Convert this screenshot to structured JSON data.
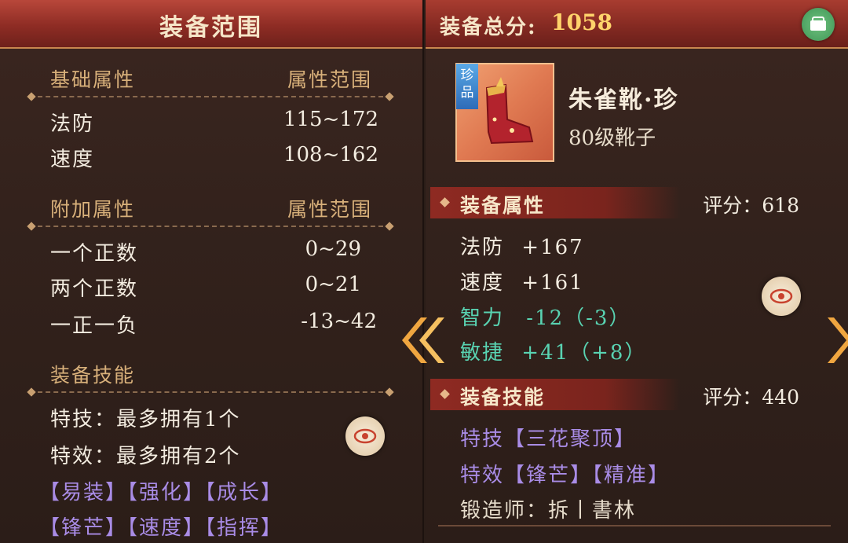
{
  "left_panel": {
    "title": "装备范围",
    "base_section": {
      "label": "基础属性",
      "range_label": "属性范围",
      "rows": [
        {
          "name": "法防",
          "range": "115~172"
        },
        {
          "name": "速度",
          "range": "108~162"
        }
      ]
    },
    "extra_section": {
      "label": "附加属性",
      "range_label": "属性范围",
      "rows": [
        {
          "name": "一个正数",
          "range": "0~29"
        },
        {
          "name": "两个正数",
          "range": "0~21"
        },
        {
          "name": "一正一负",
          "range": "-13~42"
        }
      ]
    },
    "skill_section": {
      "label": "装备技能",
      "stunt_line": "特技：最多拥有1个",
      "effect_line": "特效：最多拥有2个",
      "effect_tags_row1": "【易装】【强化】【成长】",
      "effect_tags_row2": "【锋芒】【速度】【指挥】"
    }
  },
  "right_panel": {
    "total_score_label": "装备总分:",
    "total_score_value": "1058",
    "item": {
      "rarity": "珍品",
      "name": "朱雀靴·珍",
      "type": "80级靴子"
    },
    "attr_section": {
      "label": "装备属性",
      "score": "评分：618",
      "stats": [
        {
          "name": "法防",
          "value": "+167"
        },
        {
          "name": "速度",
          "value": "+161"
        },
        {
          "name": "智力",
          "value": "-12（-3）"
        },
        {
          "name": "敏捷",
          "value": "+41（+8）"
        }
      ]
    },
    "skill_section": {
      "label": "装备技能",
      "score": "评分：440",
      "stunt": "特技【三花聚顶】",
      "effect": "特效【锋芒】【精准】",
      "smith": "锻造师：拆丨書林"
    }
  },
  "colors": {
    "header_red": "#8e2c24",
    "section_label": "#d8b07a",
    "stat_white": "#f3ece0",
    "effect_purple": "#a98ce6",
    "bonus_cyan": "#59d3b2",
    "score_gold": "#ffd36b"
  },
  "icons": {
    "share": "share-icon",
    "view": "eye-icon",
    "nav_left": "double-chevron-left-icon",
    "nav_right": "chevron-right-icon"
  }
}
